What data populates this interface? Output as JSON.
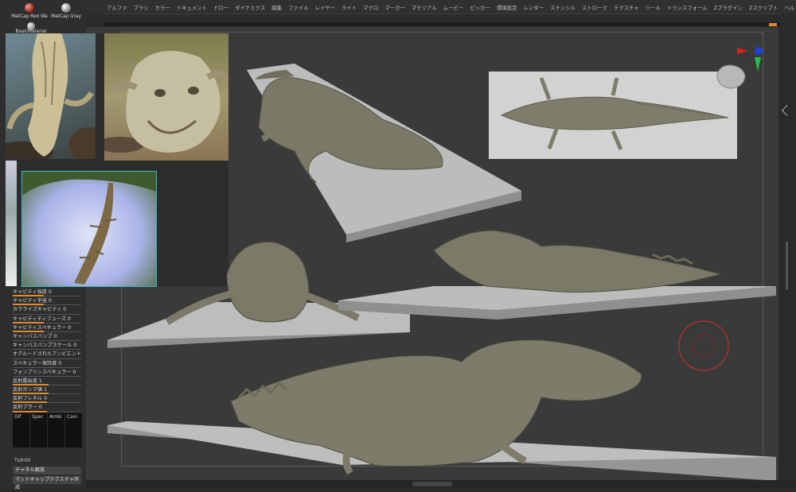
{
  "menu": [
    "アルファ",
    "ブラシ",
    "カラー",
    "ドキュメント",
    "ドロー",
    "ダイナミクス",
    "編集",
    "ファイル",
    "レイヤー",
    "ライト",
    "マクロ",
    "マーカー",
    "マテリアル",
    "ムービー",
    "ピッカー",
    "環境設定",
    "レンダー",
    "ステンシル",
    "ストローク",
    "テクスチャ",
    "ツール",
    "トランスフォーム",
    "Zプラグイン",
    "Zスクリプト",
    "ヘルプ"
  ],
  "materials": {
    "redwax": "MatCap Red Wa",
    "gray": "MatCap Gray",
    "basic": "BasicMaterial"
  },
  "properties": [
    {
      "label": "キャビティ強度 0",
      "fill": 0.45
    },
    {
      "label": "キャビティ半径 0",
      "fill": 0.45
    },
    {
      "label": "カラライズキャビティ 0",
      "fill": 0
    },
    {
      "label": "キャビティディフューズ 0",
      "fill": 0.45
    },
    {
      "label": "キャビティスペキュラー 0",
      "fill": 0.45
    },
    {
      "label": "キャンバスバンプ 0",
      "fill": 0
    },
    {
      "label": "キャンバスバンプスケール 0",
      "fill": 0
    },
    {
      "label": "オクルードされたアンビエント",
      "fill": 0
    },
    {
      "label": "スペキュラー保持度 0",
      "fill": 0
    },
    {
      "label": "フォンブリンスペキュラー 0",
      "fill": 0
    },
    {
      "label": "反射露出度 1",
      "fill": 0.52
    },
    {
      "label": "反射ガンマ値 1",
      "fill": 0.52
    },
    {
      "label": "反射フレネル 0",
      "fill": 0.5
    },
    {
      "label": "反射ブラー 0",
      "fill": 0.5
    }
  ],
  "channels": [
    "Dif",
    "Spec",
    "Ambi",
    "Cavi"
  ],
  "txtr": "Txtr00",
  "buttons": {
    "channel_release": "チャネル解放",
    "make_matcap": "マットキャップテクスチャ作成"
  },
  "colors": {
    "accent": "#e08a2a",
    "background": "#3a3a3a",
    "clay": "#7c7a68"
  }
}
